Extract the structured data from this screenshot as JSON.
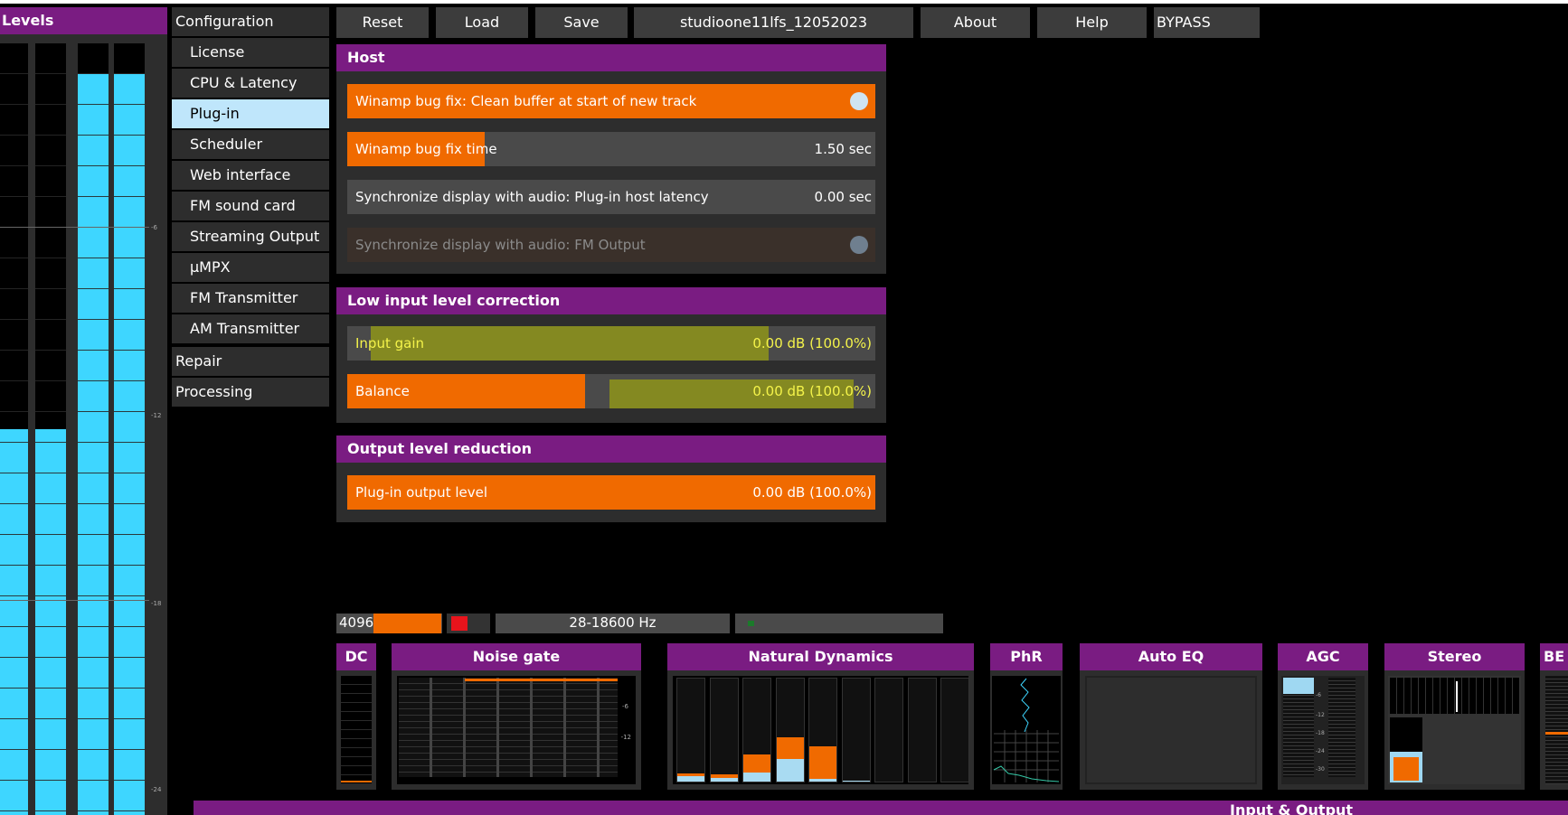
{
  "levels": {
    "title": "Levels",
    "meters": [
      {
        "level": 0.5
      },
      {
        "level": 0.5
      },
      {
        "level": 0.96
      },
      {
        "level": 0.96
      }
    ],
    "ticks": [
      "-6",
      "-12",
      "-18",
      "-24"
    ]
  },
  "menu": {
    "items": [
      {
        "label": "Configuration",
        "kind": "top"
      },
      {
        "label": "License"
      },
      {
        "label": "CPU & Latency"
      },
      {
        "label": "Plug-in",
        "active": true
      },
      {
        "label": "Scheduler"
      },
      {
        "label": "Web interface"
      },
      {
        "label": "FM sound card"
      },
      {
        "label": "Streaming Output"
      },
      {
        "label": "µMPX"
      },
      {
        "label": "FM Transmitter"
      },
      {
        "label": "AM Transmitter"
      },
      {
        "label": "Repair",
        "kind": "top"
      },
      {
        "label": "Processing",
        "kind": "top"
      }
    ]
  },
  "toolbar": {
    "reset": "Reset",
    "load": "Load",
    "save": "Save",
    "preset": "studioone11lfs_12052023",
    "about": "About",
    "help": "Help",
    "bypass": "BYPASS"
  },
  "host": {
    "title": "Host",
    "winamp_fix": {
      "label": "Winamp bug fix: Clean buffer at start of new track",
      "on": true
    },
    "winamp_time": {
      "label": "Winamp bug fix time",
      "value": "1.50 sec",
      "fraction": 0.26
    },
    "sync_latency": {
      "label": "Synchronize display with audio: Plug-in host latency",
      "value": "0.00 sec"
    },
    "sync_fm": {
      "label": "Synchronize display with audio: FM Output",
      "enabled": false
    }
  },
  "low_input": {
    "title": "Low input level correction",
    "input_gain": {
      "label": "Input gain",
      "value": "0.00 dB (100.0%)",
      "fraction": 0.0
    },
    "balance": {
      "label": "Balance",
      "value": "0.00 dB (100.0%)",
      "fraction": 0.45
    }
  },
  "output": {
    "title": "Output level reduction",
    "plugin_level": {
      "label": "Plug-in output level",
      "value": "0.00 dB (100.0%)",
      "fraction": 1.0
    }
  },
  "status": {
    "buffer": "4096",
    "buffer_fill": 0.64,
    "freq": "28-18600 Hz"
  },
  "modules": {
    "dc": "DC",
    "noise_gate": "Noise gate",
    "noise_gate_ticks": [
      "-6",
      "-12"
    ],
    "natural_dynamics": "Natural Dynamics",
    "nd_bars": [
      {
        "orange": 0.03,
        "blue": 0.05
      },
      {
        "orange": 0.03,
        "blue": 0.04
      },
      {
        "orange": 0.18,
        "blue": 0.09
      },
      {
        "orange": 0.22,
        "blue": 0.22
      },
      {
        "orange": 0.32,
        "blue": 0.03
      },
      {
        "orange": 0.0,
        "blue": 0.01
      },
      {
        "orange": 0,
        "blue": 0
      },
      {
        "orange": 0,
        "blue": 0
      },
      {
        "orange": 0,
        "blue": 0
      }
    ],
    "phr": "PhR",
    "auto_eq": "Auto EQ",
    "agc": "AGC",
    "agc_ticks": [
      "-6",
      "-12",
      "-18",
      "-24",
      "-30"
    ],
    "stereo": "Stereo",
    "be": "BE",
    "input_output": "Input & Output"
  },
  "colors": {
    "accent": "#7a1c82",
    "orange": "#f06a00",
    "meter": "#3ed6ff",
    "active": "#bfe6fb"
  }
}
